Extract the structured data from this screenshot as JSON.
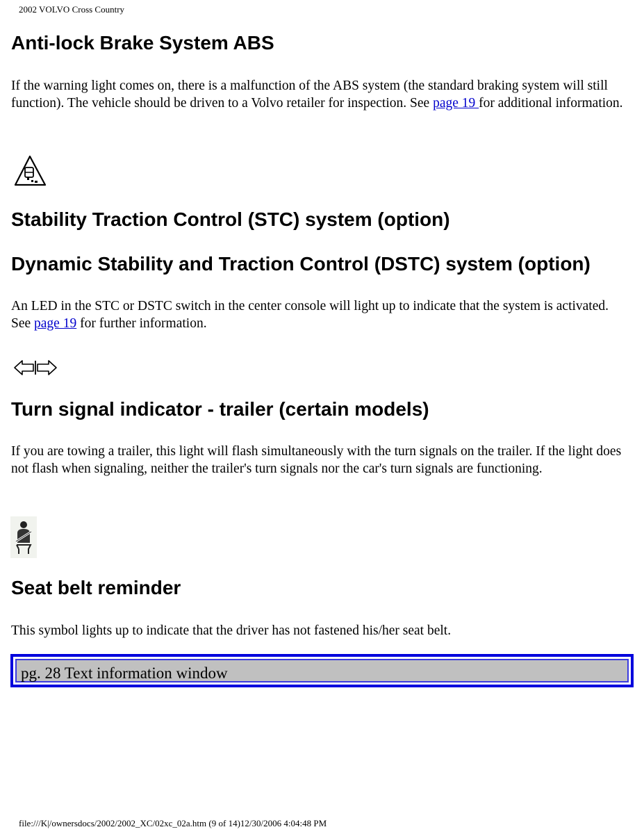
{
  "header": {
    "title": "2002 VOLVO Cross Country"
  },
  "sections": [
    {
      "heading": "Anti-lock Brake System ABS",
      "body_before_link": "If the warning light comes on, there is a malfunction of the ABS system (the standard braking system will still function). The vehicle should be driven to a Volvo retailer for inspection. See ",
      "link": "page 19 ",
      "body_after_link": "for additional information."
    },
    {
      "icon": "stability-traction-warning-icon",
      "heading": "Stability Traction Control (STC) system (option)"
    },
    {
      "heading": "Dynamic Stability and Traction Control (DSTC) system (option)",
      "body_before_link": "An LED in the STC or DSTC switch in the center console will light up to indicate that the system is activated. See ",
      "link": "page 19",
      "body_after_link": " for further information."
    },
    {
      "icon": "trailer-turn-signal-icon",
      "heading": "Turn signal indicator - trailer (certain models)",
      "body": "If you are towing a trailer, this light will flash simultaneously with the turn signals on the trailer. If the light does not flash when signaling, neither the trailer's turn signals nor the car's turn signals are functioning."
    },
    {
      "icon": "seat-belt-icon",
      "heading": "Seat belt reminder",
      "body": "This symbol lights up to indicate that the driver has not fastened his/her seat belt."
    }
  ],
  "nav": {
    "next_label": "pg. 28 Text information window"
  },
  "footer": {
    "text": "file:///K|/ownersdocs/2002/2002_XC/02xc_02a.htm (9 of 14)12/30/2006 4:04:48 PM"
  }
}
